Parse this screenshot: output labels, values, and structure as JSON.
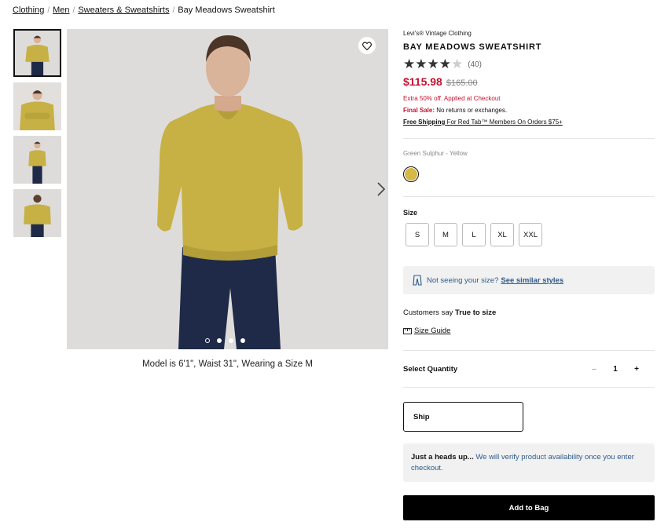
{
  "breadcrumb": {
    "items": [
      "Clothing",
      "Men",
      "Sweaters & Sweatshirts"
    ],
    "current": "Bay Meadows Sweatshirt"
  },
  "gallery": {
    "caption": "Model is 6'1\", Waist 31\", Wearing a Size M",
    "slide_count": 4,
    "active_slide": 1
  },
  "product": {
    "brand": "Levi's® Vintage Clothing",
    "title": "BAY MEADOWS SWEATSHIRT",
    "rating": 4.5,
    "rating_count": "(40)",
    "sale_price": "$115.98",
    "original_price": "$165.00",
    "promo": "Extra 50% off. Applied at Checkout",
    "final_sale_label": "Final Sale:",
    "final_sale_text": " No returns or exchanges.",
    "free_shipping_label": "Free Shipping",
    "free_shipping_text": " For Red Tab™ Members On Orders $75+"
  },
  "color": {
    "label": "Green Sulphur - Yellow",
    "swatch": "#d5b846"
  },
  "size": {
    "label": "Size",
    "options": [
      "S",
      "M",
      "L",
      "XL",
      "XXL"
    ]
  },
  "fit_help": {
    "question": "Not seeing your size?",
    "link": "See similar styles"
  },
  "fit": {
    "prefix": "Customers say ",
    "value": "True to size",
    "size_guide": "Size Guide"
  },
  "quantity": {
    "label": "Select Quantity",
    "minus": "–",
    "value": "1",
    "plus": "+"
  },
  "shipping": {
    "option": "Ship"
  },
  "notice": {
    "title": "Just a heads up...",
    "text": " We will verify product availability once you enter checkout."
  },
  "cta": {
    "add_to_bag": "Add to Bag"
  },
  "colors": {
    "sale_red": "#c41230",
    "link_blue": "#2d5a8a",
    "sweater": "#c7b144",
    "jeans": "#1f2a48"
  }
}
